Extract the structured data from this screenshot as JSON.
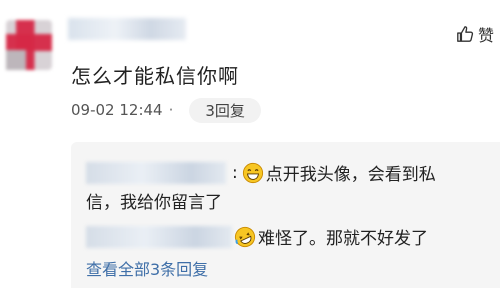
{
  "post": {
    "like_label": "赞",
    "comment_text": "怎么才能私信你啊",
    "timestamp": "09-02 12:44",
    "dot": "·",
    "reply_count_label": "3回复"
  },
  "replies": [
    {
      "separator": ":",
      "emoji_icon": "grinning-face-icon",
      "text_line1": "点开我头像，会看到私",
      "text_line2": "信，我给你留言了"
    },
    {
      "emoji_icon": "rolling-laughing-face-icon",
      "text": "难怪了。那就不好发了"
    }
  ],
  "view_more_label": "查看全部3条回复",
  "colors": {
    "link": "#3f6fa8",
    "reply_background": "#f5f5f5",
    "pill_background": "#f2f2f2"
  }
}
